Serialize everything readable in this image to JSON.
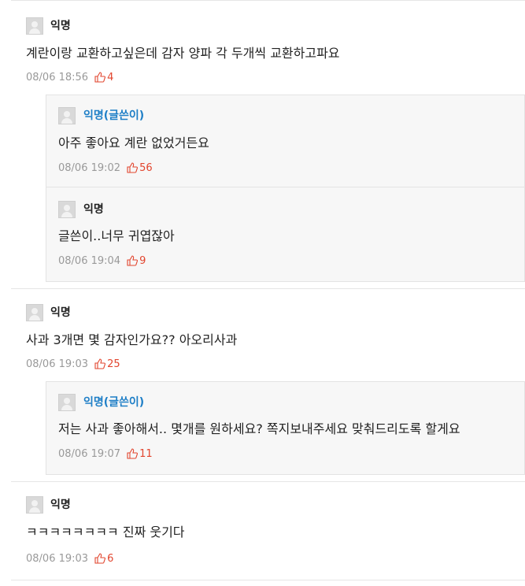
{
  "comments": [
    {
      "author": "익명",
      "text": "계란이랑 교환하고싶은데 감자 양파 각 두개씩 교환하고파요",
      "date": "08/06 18:56",
      "likes": "4",
      "replies": [
        {
          "author": "익명(글쓴이)",
          "text": "아주 좋아요 계란 없었거든요",
          "date": "08/06 19:02",
          "likes": "56"
        },
        {
          "author": "익명",
          "text": "글쓴이..너무 귀엽잖아",
          "date": "08/06 19:04",
          "likes": "9"
        }
      ]
    },
    {
      "author": "익명",
      "text": "사과 3개면 몇 감자인가요?? 아오리사과",
      "date": "08/06 19:03",
      "likes": "25",
      "replies": [
        {
          "author": "익명(글쓴이)",
          "text": "저는 사과 좋아해서.. 몇개를 원하세요? 쪽지보내주세요 맞춰드리도록 할게요",
          "date": "08/06 19:07",
          "likes": "11"
        }
      ]
    },
    {
      "author": "익명",
      "text": "ㅋㅋㅋㅋㅋㅋㅋㅋ 진짜 웃기다",
      "date": "08/06 19:03",
      "likes": "6",
      "replies": []
    }
  ],
  "colors": {
    "author_highlight": "#1f7fc7",
    "like": "#e2452e",
    "meta": "#999999"
  },
  "icons": {
    "avatar": "avatar-icon",
    "like": "thumbs-up-icon"
  }
}
